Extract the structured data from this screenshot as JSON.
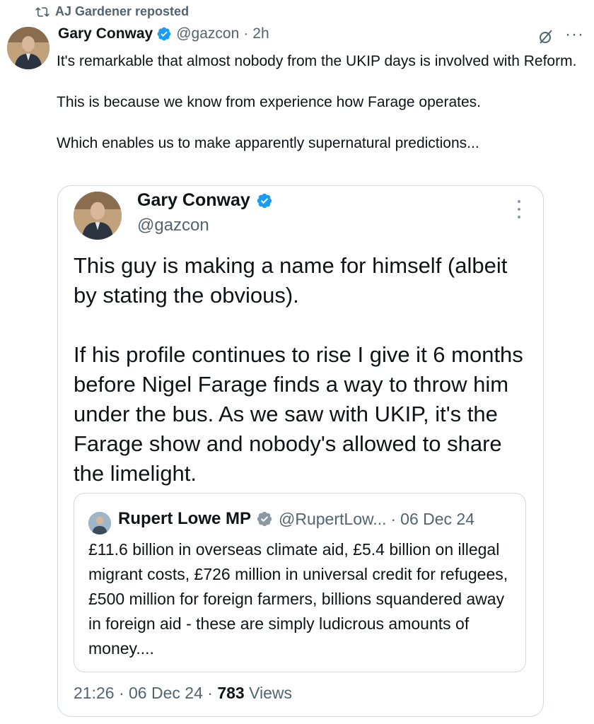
{
  "repost": {
    "label": "AJ Gardener reposted"
  },
  "post": {
    "author_name": "Gary Conway",
    "handle": "@gazcon",
    "separator": "·",
    "time": "2h",
    "paragraphs": [
      "It's remarkable that almost nobody from the UKIP days is involved with Reform.",
      "This is because we know from experience how Farage operates.",
      "Which enables us to make apparently supernatural predictions..."
    ]
  },
  "quoted": {
    "author_name": "Gary Conway",
    "handle": "@gazcon",
    "paragraphs": [
      "This guy is making a name for himself (albeit by stating the obvious).",
      "If his profile continues to rise I give it 6 months before Nigel Farage finds a way to throw him under the bus. As we saw with UKIP, it's the Farage show and nobody's allowed to share the limelight."
    ],
    "inner_quote": {
      "author_name": "Rupert Lowe MP",
      "handle": "@RupertLow...",
      "separator": "·",
      "date": "06 Dec 24",
      "text": "£11.6 billion in overseas climate aid, £5.4 billion on illegal migrant costs, £726 million in universal credit for refugees, £500 million for foreign farmers, billions squandered away in foreign aid - these are simply ludicrous amounts of money...."
    },
    "footer": {
      "time": "21:26",
      "date": "06 Dec 24",
      "separator": "·",
      "views_count": "783",
      "views_label": "Views"
    }
  },
  "colors": {
    "verified": "#1d9bf0",
    "inner_verified": "#8b98a5",
    "muted_text": "#536471",
    "border": "#cfd9de"
  }
}
